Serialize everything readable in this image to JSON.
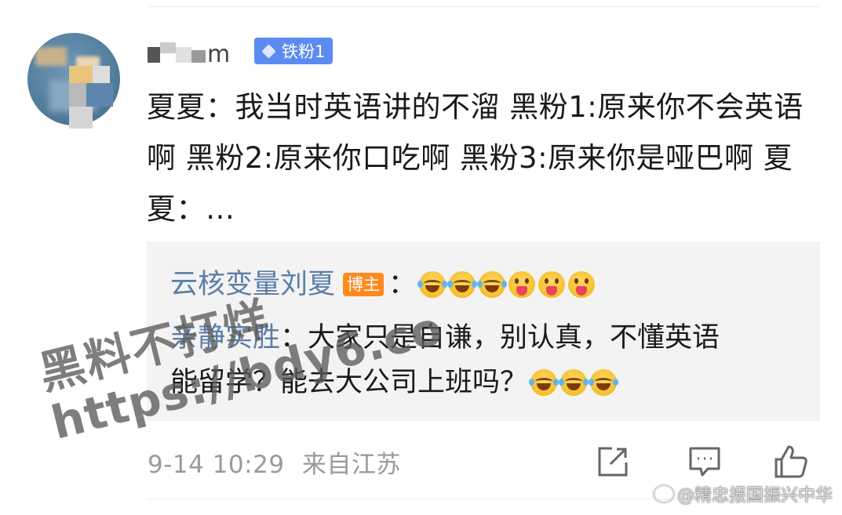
{
  "user": {
    "name_visible": "m",
    "badge": "铁粉1"
  },
  "comment": {
    "text": "夏夏：我当时英语讲的不溜  黑粉1:原来你不会英语啊  黑粉2:原来你口吃啊 黑粉3:原来你是哑巴啊 夏夏：…"
  },
  "replies": [
    {
      "name": "云核变量刘夏",
      "badge": "博主",
      "text": "："
    },
    {
      "name": "亲静实胜",
      "line1": "：大家只是自谦，别认真，不懂英语",
      "line2": "能留学？能去大公司上班吗？"
    }
  ],
  "footer": {
    "time": "9-14 10:29",
    "location": "来自江苏"
  },
  "watermark": {
    "line1": "黑料不打烊",
    "line2": "https://bdy6.co"
  },
  "credit": "@精忠报国振兴中华",
  "colors": {
    "badge_blue": "#5b8bf2",
    "blogger_orange": "#ff8a1e",
    "reply_name": "#5b7ea8",
    "reply_bg": "#f3f3f3",
    "timestamp": "#9a9a9a"
  },
  "icons": {
    "share": "share-icon",
    "comment": "comment-icon",
    "like": "like-icon",
    "emoji_laugh": "laugh-cry-emoji",
    "emoji_tongue": "tongue-emoji"
  }
}
